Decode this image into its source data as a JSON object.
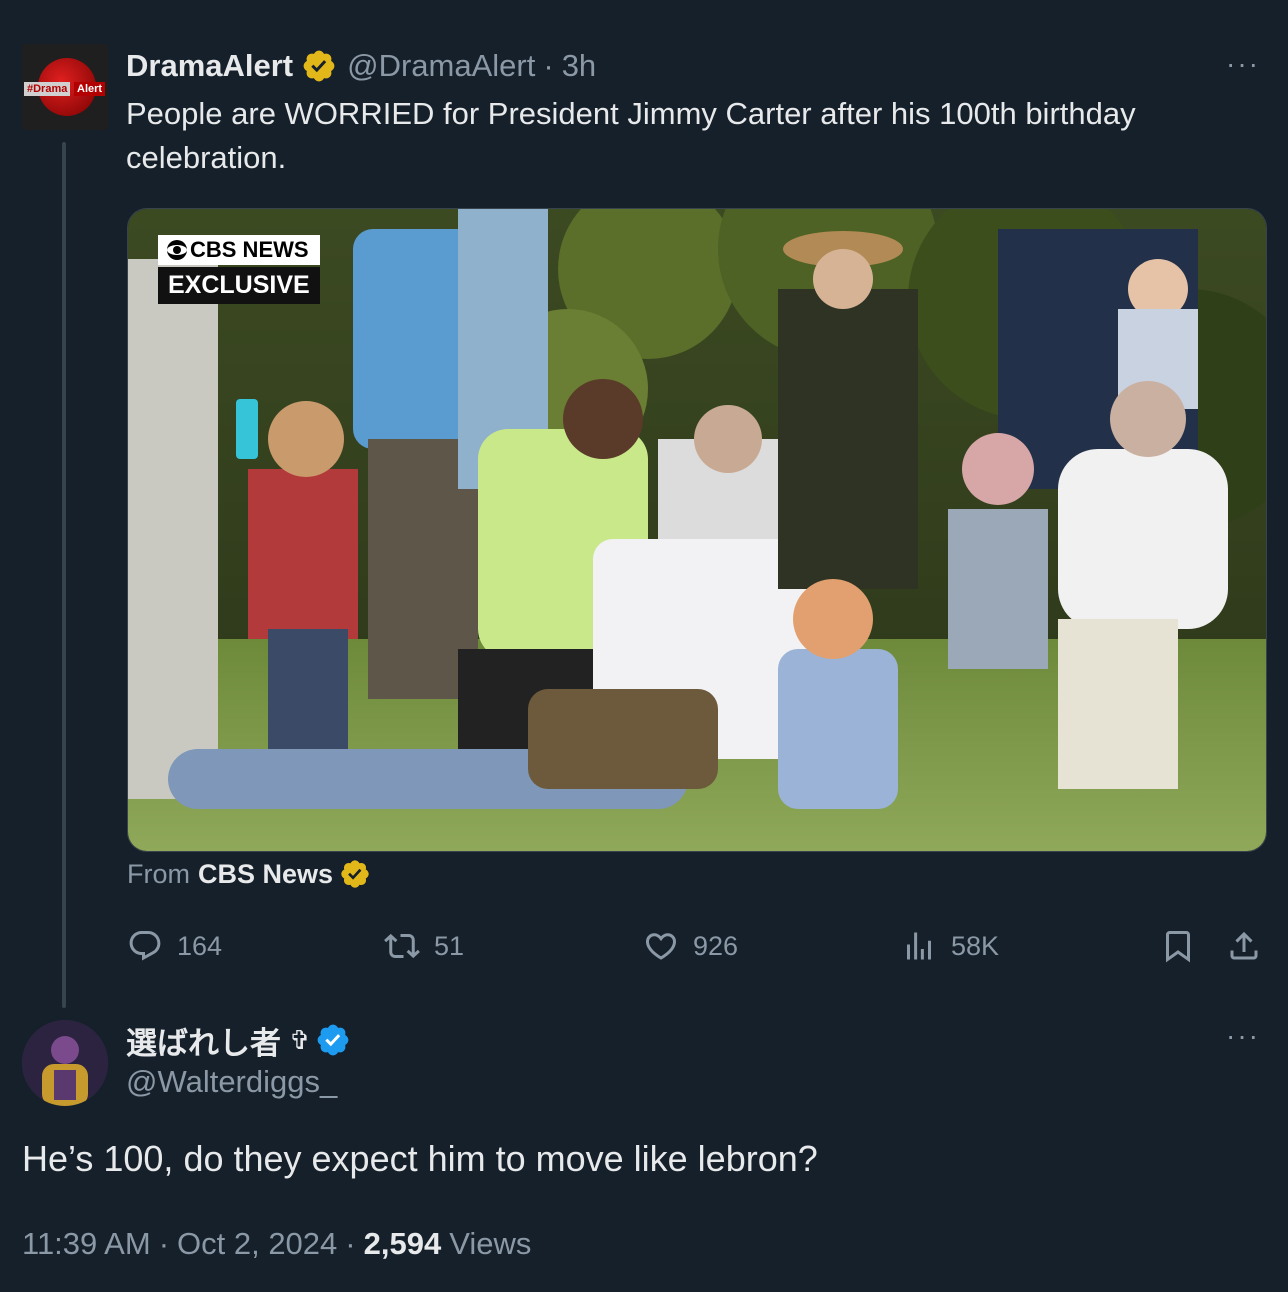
{
  "tweet": {
    "author_name": "DramaAlert",
    "author_handle": "@DramaAlert",
    "time_sep": "·",
    "time": "3h",
    "avatar_text_1": "#Drama",
    "avatar_text_2": "Alert",
    "text": "People are WORRIED for President Jimmy Carter after his 100th birthday celebration.",
    "media": {
      "badge_line1": "CBS NEWS",
      "badge_line2": "EXCLUSIVE"
    },
    "from_prefix": "From",
    "from_source": "CBS News",
    "actions": {
      "replies": "164",
      "reposts": "51",
      "likes": "926",
      "views": "58K"
    },
    "more_label": "···"
  },
  "reply": {
    "author_name": "選ばれし者",
    "author_symbol": "✞",
    "author_handle": "@Walterdiggs_",
    "text": "He’s 100, do they expect him to move like lebron?",
    "time": "11:39 AM",
    "sep1": "·",
    "date": "Oct 2, 2024",
    "sep2": "·",
    "views_count": "2,594",
    "views_label": "Views",
    "more_label": "···"
  },
  "colors": {
    "background": "#15202b",
    "text_primary": "#e7e9ea",
    "text_secondary": "#8b98a5",
    "gold_verified": "#e2b719",
    "blue_verified": "#1d9bf0",
    "thread_line": "#38444d"
  },
  "icons": [
    "reply-icon",
    "repost-icon",
    "like-icon",
    "views-icon",
    "bookmark-icon",
    "share-icon",
    "gold-verified-badge-icon",
    "blue-verified-badge-icon",
    "more-icon",
    "cbs-eye-icon"
  ]
}
